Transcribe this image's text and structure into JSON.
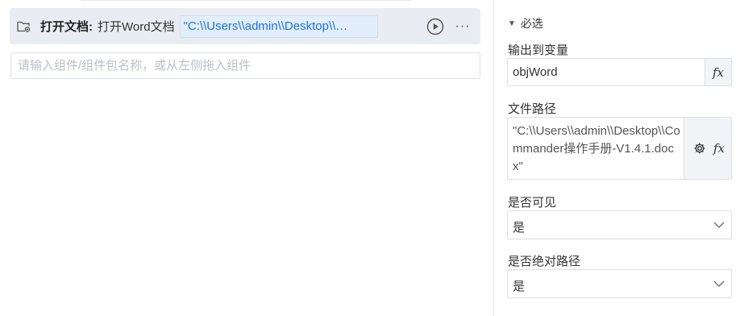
{
  "step": {
    "title": "打开文档:",
    "description": "打开Word文档",
    "path_value": "\"C:\\\\Users\\\\admin\\\\Desktop\\\\…",
    "more_label": "···"
  },
  "component_search": {
    "placeholder": "请输入组件/组件包名称，或从左侧拖入组件"
  },
  "panel": {
    "section_title": "必选",
    "output_var": {
      "label": "输出到变量",
      "value": "objWord",
      "fx_label": "fx"
    },
    "file_path": {
      "label": "文件路径",
      "value": "\"C:\\\\Users\\\\admin\\\\Desktop\\\\Commander操作手册-V1.4.1.docx\"",
      "fx_label": "fx"
    },
    "visible": {
      "label": "是否可见",
      "value": "是"
    },
    "absolute_path": {
      "label": "是否绝对路径",
      "value": "是"
    }
  },
  "colors": {
    "accent": "#1a73e8",
    "step_bg": "#e9ecf2",
    "path_bg": "#e3eefb",
    "border": "#dcdfe6"
  }
}
